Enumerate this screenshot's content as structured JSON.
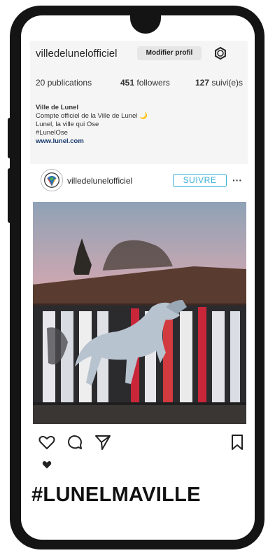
{
  "profile": {
    "username": "villedelunelofficiel",
    "edit_label": "Modifier profil",
    "stats": {
      "posts_count": "20",
      "posts_label": "publications",
      "followers_count": "451",
      "followers_label": "followers",
      "following_count": "127",
      "following_label": "suivi(e)s"
    },
    "bio": {
      "name": "Ville de Lunel",
      "line1": "Compte officiel de la Ville de Lunel 🌙",
      "line2": "Lunel, la ville qui Ose",
      "line3": "#LunelOse",
      "link": "www.lunel.com"
    }
  },
  "post": {
    "username": "villedelunelofficiel",
    "follow_label": "SUIVRE",
    "more": "···"
  },
  "caption": {
    "hashtag": "#LUNELMAVILLE"
  },
  "colors": {
    "frame": "#141414",
    "accent": "#3ab0d6",
    "card": "#f5f5f5"
  },
  "icons": [
    "settings-icon",
    "heart-icon",
    "comment-icon",
    "share-icon",
    "bookmark-icon",
    "more-icon"
  ]
}
